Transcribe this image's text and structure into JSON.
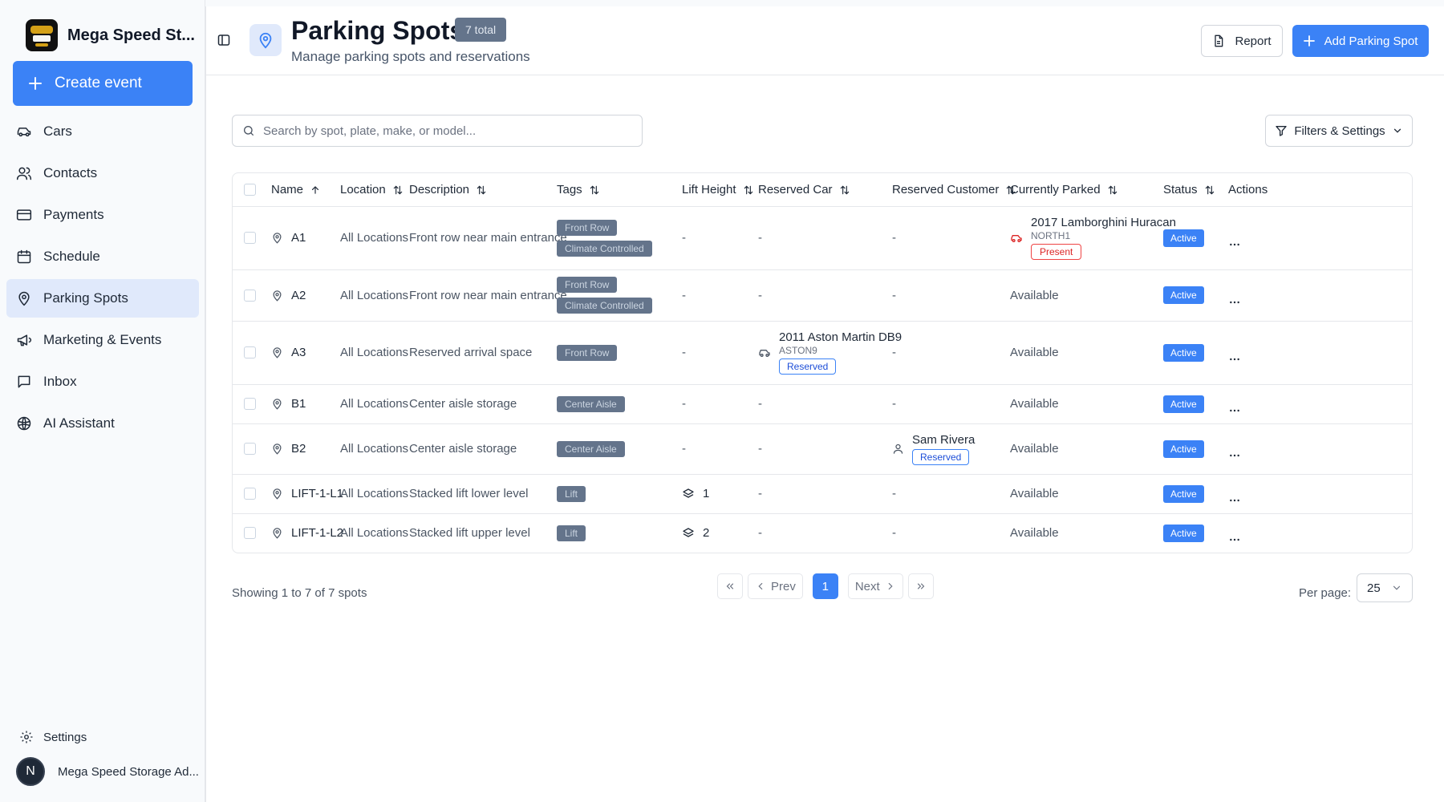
{
  "sidebar": {
    "brand_name": "Mega Speed St...",
    "create_label": "Create event",
    "items": [
      {
        "label": "Cars",
        "icon": "car-icon"
      },
      {
        "label": "Contacts",
        "icon": "users-icon"
      },
      {
        "label": "Payments",
        "icon": "credit-card-icon"
      },
      {
        "label": "Schedule",
        "icon": "calendar-icon"
      },
      {
        "label": "Parking Spots",
        "icon": "map-pin-icon",
        "active": true
      },
      {
        "label": "Marketing & Events",
        "icon": "megaphone-icon"
      },
      {
        "label": "Inbox",
        "icon": "message-icon"
      },
      {
        "label": "AI Assistant",
        "icon": "ai-icon"
      }
    ],
    "settings_label": "Settings",
    "user_initial": "N",
    "user_name": "Mega Speed Storage Ad..."
  },
  "header": {
    "title": "Parking Spots",
    "total_badge": "7 total",
    "subtitle": "Manage parking spots and reservations",
    "report_label": "Report",
    "add_label": "Add Parking Spot"
  },
  "toolbar": {
    "search_placeholder": "Search by spot, plate, make, or model...",
    "filters_label": "Filters & Settings"
  },
  "table": {
    "columns": [
      "Name",
      "Location",
      "Description",
      "Tags",
      "Lift Height",
      "Reserved Car",
      "Reserved Customer",
      "Currently Parked",
      "Status",
      "Actions"
    ],
    "rows": [
      {
        "name": "A1",
        "location": "All Locations",
        "description": "Front row near main entrance",
        "tags": [
          "Front Row",
          "Climate Controlled"
        ],
        "lift": "-",
        "reserved_car": "-",
        "reserved_customer": "-",
        "parked": {
          "title": "2017 Lamborghini Huracan",
          "plate": "NORTH1",
          "badge": "Present"
        },
        "status": "Active"
      },
      {
        "name": "A2",
        "location": "All Locations",
        "description": "Front row near main entrance",
        "tags": [
          "Front Row",
          "Climate Controlled"
        ],
        "lift": "-",
        "reserved_car": "-",
        "reserved_customer": "-",
        "parked": "Available",
        "status": "Active"
      },
      {
        "name": "A3",
        "location": "All Locations",
        "description": "Reserved arrival space",
        "tags": [
          "Front Row"
        ],
        "lift": "-",
        "reserved_car": {
          "title": "2011 Aston Martin DB9",
          "plate": "ASTON9",
          "badge": "Reserved"
        },
        "reserved_customer": "-",
        "parked": "Available",
        "status": "Active"
      },
      {
        "name": "B1",
        "location": "All Locations",
        "description": "Center aisle storage",
        "tags": [
          "Center Aisle"
        ],
        "lift": "-",
        "reserved_car": "-",
        "reserved_customer": "-",
        "parked": "Available",
        "status": "Active"
      },
      {
        "name": "B2",
        "location": "All Locations",
        "description": "Center aisle storage",
        "tags": [
          "Center Aisle"
        ],
        "lift": "-",
        "reserved_car": "-",
        "reserved_customer": {
          "name": "Sam Rivera",
          "badge": "Reserved"
        },
        "parked": "Available",
        "status": "Active"
      },
      {
        "name": "LIFT-1-L1",
        "location": "All Locations",
        "description": "Stacked lift lower level",
        "tags": [
          "Lift"
        ],
        "lift": "1",
        "reserved_car": "-",
        "reserved_customer": "-",
        "parked": "Available",
        "status": "Active"
      },
      {
        "name": "LIFT-1-L2",
        "location": "All Locations",
        "description": "Stacked lift upper level",
        "tags": [
          "Lift"
        ],
        "lift": "2",
        "reserved_car": "-",
        "reserved_customer": "-",
        "parked": "Available",
        "status": "Active"
      }
    ]
  },
  "footer": {
    "showing": "Showing 1 to 7 of 7 spots",
    "prev_label": "Prev",
    "next_label": "Next",
    "current_page": "1",
    "per_page_label": "Per page:",
    "per_page_value": "25"
  },
  "colors": {
    "accent": "#3b82f6",
    "tag": "#64748b",
    "present": "#dc2626"
  }
}
